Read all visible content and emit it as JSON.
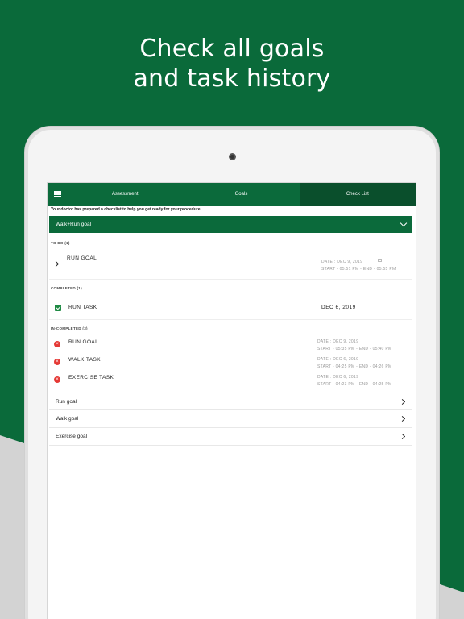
{
  "promo": {
    "line1": "Check all goals",
    "line2": "and task history"
  },
  "colors": {
    "brand_green": "#0b6a3b",
    "active_tab": "#0a4f2c",
    "complete": "#1f8a44",
    "incomplete": "#e53935"
  },
  "tabs": [
    {
      "label": "Assessment"
    },
    {
      "label": "Goals"
    },
    {
      "label": "Check List",
      "active": true
    }
  ],
  "notice": "Your doctor has prepared a checklist to help you get ready for your procedure.",
  "goal_select": {
    "value": "Walk+Run goal"
  },
  "todo": {
    "label": "TO DO (1)",
    "items": [
      {
        "title": "RUN GOAL",
        "date": "DATE : DEC 9, 2019",
        "time": "START - 05:51 PM - END - 05:55 PM"
      }
    ]
  },
  "completed": {
    "label": "COMPLETED (1)",
    "items": [
      {
        "title": "RUN TASK",
        "date": "DEC 6, 2019"
      }
    ]
  },
  "incompleted": {
    "label": "IN-COMPLETED (3)",
    "items": [
      {
        "title": "RUN GOAL",
        "date": "DATE : DEC 9, 2019",
        "time": "START - 05:35 PM - END - 05:40 PM"
      },
      {
        "title": "WALK TASK",
        "date": "DATE : DEC 6, 2019",
        "time": "START - 04:25 PM - END - 04:26 PM"
      },
      {
        "title": "EXERCISE TASK",
        "date": "DATE : DEC 6, 2019",
        "time": "START - 04:23 PM - END - 04:25 PM"
      }
    ]
  },
  "goal_links": [
    {
      "label": "Run goal"
    },
    {
      "label": "Walk goal"
    },
    {
      "label": "Exercise goal"
    }
  ]
}
